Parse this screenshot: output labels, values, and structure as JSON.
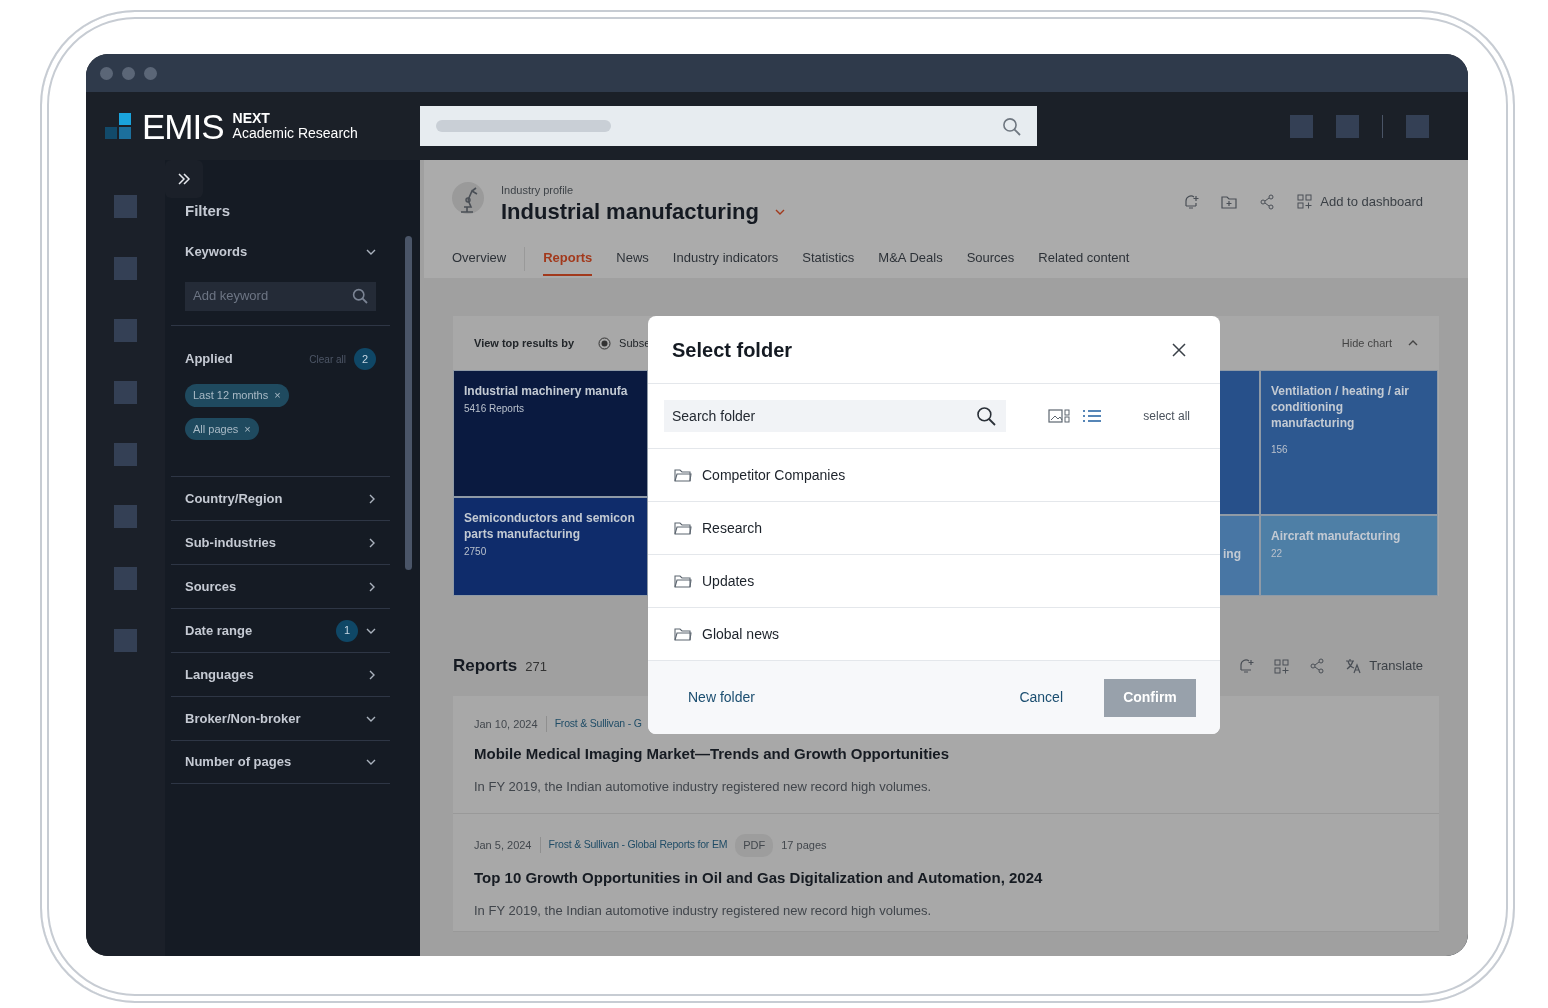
{
  "header": {
    "logo": {
      "wordmark": "EMIS",
      "edition": "NEXT",
      "product": "Academic Research"
    }
  },
  "filters": {
    "title": "Filters",
    "keywords": {
      "label": "Keywords",
      "placeholder": "Add keyword"
    },
    "applied": {
      "label": "Applied",
      "clear": "Clear all",
      "count": "2",
      "chips": [
        {
          "label": "Last 12 months",
          "remove": "×"
        },
        {
          "label": "All pages",
          "remove": "×"
        }
      ]
    },
    "items": [
      {
        "label": "Country/Region",
        "kind": "drilldown"
      },
      {
        "label": "Sub-industries",
        "kind": "drilldown"
      },
      {
        "label": "Sources",
        "kind": "drilldown"
      },
      {
        "label": "Date range",
        "kind": "dropdown",
        "count": "1"
      },
      {
        "label": "Languages",
        "kind": "drilldown"
      },
      {
        "label": "Broker/Non-broker",
        "kind": "dropdown"
      },
      {
        "label": "Number of pages",
        "kind": "dropdown"
      }
    ]
  },
  "page_header": {
    "eyebrow": "Industry profile",
    "title": "Industrial manufacturing",
    "action": "Add to dashboard"
  },
  "tabs": [
    {
      "label": "Overview",
      "selected": false
    },
    {
      "label": "Reports",
      "selected": true
    },
    {
      "label": "News",
      "selected": false
    },
    {
      "label": "Industry indicators",
      "selected": false
    },
    {
      "label": "Statistics",
      "selected": false
    },
    {
      "label": "M&A Deals",
      "selected": false
    },
    {
      "label": "Sources",
      "selected": false
    },
    {
      "label": "Related content",
      "selected": false
    }
  ],
  "chart": {
    "label": "View top results by",
    "option": {
      "label": "Subse",
      "checked": true
    },
    "toggle": "Hide chart",
    "columns": [
      [
        {
          "title": "Industrial machinery manufa",
          "count": "5416 Reports",
          "color": "#0a1a40"
        },
        {
          "title": "Semiconductors and semicon\nparts manufacturing",
          "count": "2750",
          "color": "#0f2c6b"
        }
      ],
      [
        {
          "color": "#27508a"
        },
        {
          "title": "ing",
          "color": "#4876a4"
        }
      ],
      [
        {
          "title": "Ventilation / heating / air conditioning manufacturing",
          "count": "156",
          "color": "#2d5890"
        },
        {
          "title": "Aircraft manufacturing",
          "count": "22",
          "color": "#4e7fa6"
        }
      ]
    ]
  },
  "reports": {
    "title": "Reports",
    "count": "271",
    "action": "Translate",
    "items": [
      {
        "date": "Jan 10, 2024",
        "source": "Frost & Sullivan - G",
        "title": "Mobile Medical Imaging Market—Trends and Growth Opportunities",
        "summary": "In FY 2019, the Indian automotive industry registered new record high volumes."
      },
      {
        "date": "Jan 5, 2024",
        "source": "Frost & Sullivan - Global Reports for EM",
        "format": "PDF",
        "pages": "17 pages",
        "title": "Top 10 Growth Opportunities in Oil and Gas Digitalization and Automation, 2024",
        "summary": "In FY 2019, the Indian automotive industry registered new record high volumes."
      }
    ]
  },
  "dialog": {
    "title": "Select folder",
    "search": {
      "placeholder": "Search folder"
    },
    "views": [
      {
        "kind": "gallery",
        "selected": false
      },
      {
        "kind": "list",
        "selected": true
      }
    ],
    "select_all": "select all",
    "folders": [
      "Competitor Companies",
      "Research",
      "Updates",
      "Global news"
    ],
    "new_folder": "New folder",
    "cancel": "Cancel",
    "confirm": {
      "label": "Confirm",
      "disabled": true
    }
  }
}
